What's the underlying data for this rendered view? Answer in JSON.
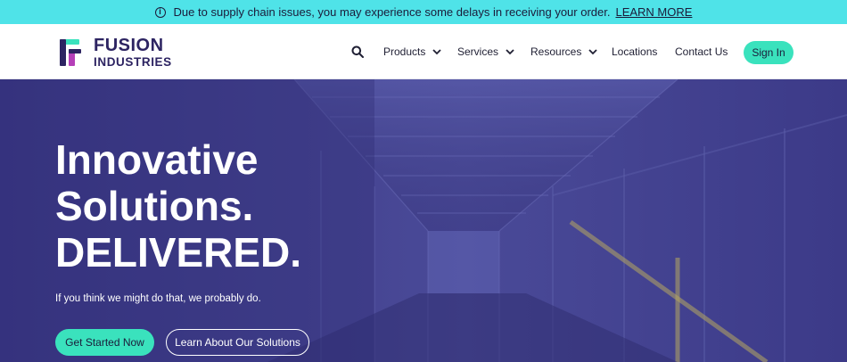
{
  "announcement": {
    "icon": "info-icon",
    "message": "Due to supply chain issues, you may experience some delays in receiving your order.",
    "link_label": "LEARN MORE"
  },
  "header": {
    "logo": {
      "line1": "FUSION",
      "line2": "INDUSTRIES"
    },
    "search_icon": "search-icon",
    "nav": [
      {
        "label": "Products",
        "has_dropdown": true
      },
      {
        "label": "Services",
        "has_dropdown": true
      },
      {
        "label": "Resources",
        "has_dropdown": true
      },
      {
        "label": "Locations",
        "has_dropdown": false
      },
      {
        "label": "Contact Us",
        "has_dropdown": false
      }
    ],
    "signin_label": "Sign In"
  },
  "hero": {
    "title_line1": "Innovative",
    "title_line2": "Solutions.",
    "title_line3": "DELIVERED.",
    "subtitle": "If you think we might do that, we probably do.",
    "primary_cta": "Get Started Now",
    "secondary_cta": "Learn About Our Solutions"
  },
  "colors": {
    "announcement_bg": "#4fe3e8",
    "brand_navy": "#2d2462",
    "accent_green": "#3ae2bd",
    "hero_overlay": "#3d3a8a"
  }
}
